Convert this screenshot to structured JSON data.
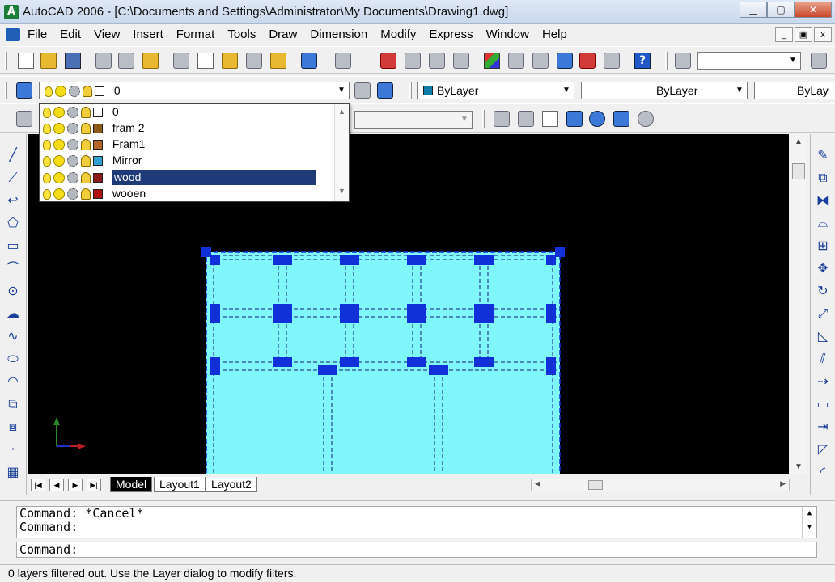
{
  "window": {
    "title": "AutoCAD 2006 - [C:\\Documents and Settings\\Administrator\\My Documents\\Drawing1.dwg]",
    "minimize": "▁",
    "maximize": "▢",
    "close": "✕"
  },
  "menu": {
    "items": [
      "File",
      "Edit",
      "View",
      "Insert",
      "Format",
      "Tools",
      "Draw",
      "Dimension",
      "Modify",
      "Express",
      "Window",
      "Help"
    ],
    "mdi_minimize": "_",
    "mdi_restore": "▣",
    "mdi_close": "x"
  },
  "layers_toolbar": {
    "current_layer": "0"
  },
  "properties_toolbar": {
    "color": "ByLayer",
    "color_swatch": "#0f7ba6",
    "linetype": "ByLayer",
    "lineweight": "ByLay"
  },
  "layer_dropdown": {
    "items": [
      {
        "name": "0",
        "color": "#ffffff"
      },
      {
        "name": "fram 2",
        "color": "#8b5a16"
      },
      {
        "name": "Fram1",
        "color": "#b5652a"
      },
      {
        "name": "Mirror",
        "color": "#33a0d4"
      },
      {
        "name": "wood",
        "color": "#8a1a1a"
      },
      {
        "name": "wooen",
        "color": "#b01212"
      }
    ],
    "selected": "wood"
  },
  "tabs": {
    "model": "Model",
    "layout1": "Layout1",
    "layout2": "Layout2"
  },
  "command": {
    "history": [
      "Command: *Cancel*",
      "Command:"
    ],
    "prompt": "Command:"
  },
  "status": {
    "text": "0 layers filtered out.  Use the Layer dialog to modify filters."
  },
  "colors": {
    "canvas_bg": "#000000",
    "drawing_fill": "#7ff6fa",
    "grip": "#1230d8",
    "selection": "#1f3a78"
  },
  "icons": {
    "left_toolbar": [
      "line-icon",
      "construction-line-icon",
      "polyline-icon",
      "polygon-icon",
      "rectangle-icon",
      "arc-icon",
      "circle-icon",
      "revision-cloud-icon",
      "spline-icon",
      "ellipse-icon",
      "ellipse-arc-icon",
      "insert-block-icon",
      "make-block-icon",
      "point-icon",
      "hatch-icon"
    ],
    "right_toolbar": [
      "erase-icon",
      "copy-icon",
      "mirror-icon",
      "offset-icon",
      "array-icon",
      "move-icon",
      "rotate-icon",
      "scale-icon",
      "stretch-icon",
      "trim-icon",
      "extend-icon",
      "break-icon",
      "join-icon",
      "chamfer-icon",
      "fillet-icon"
    ]
  }
}
